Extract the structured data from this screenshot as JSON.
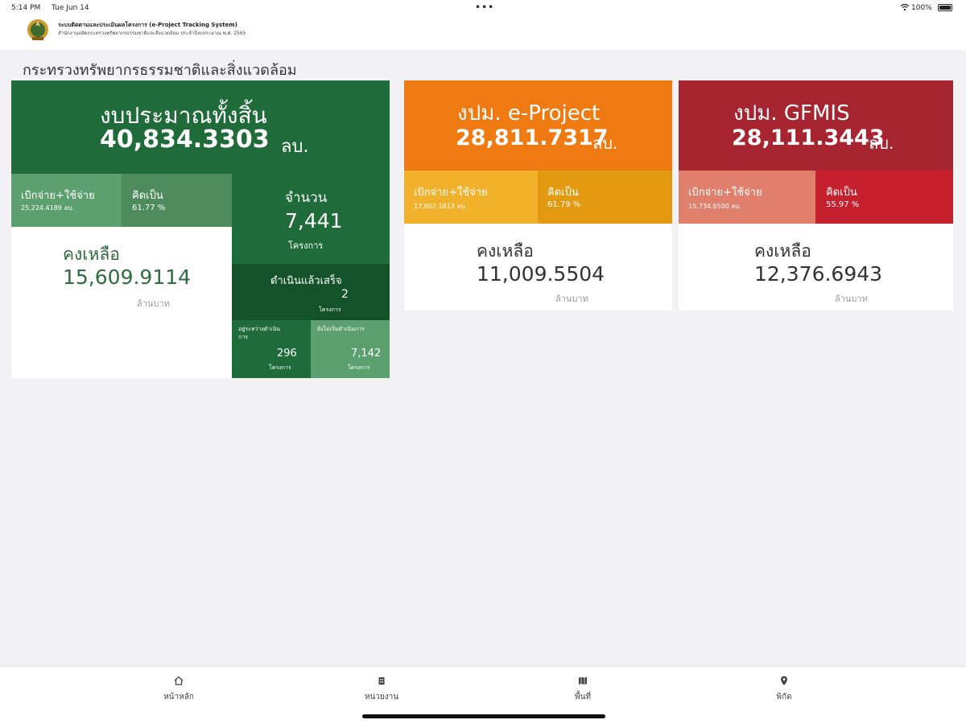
{
  "status": {
    "time": "5:14 PM",
    "date": "Tue Jun 14",
    "battery": "100%"
  },
  "header": {
    "title": "ระบบติดตามและประเมินผลโครงการ (e-Project Tracking System)",
    "subtitle": "สำนักงานปลัดกระทรวงทรัพยากรธรรมชาติและสิ่งแวดล้อม ประจำปีงบประมาณ พ.ศ. 2565"
  },
  "ministry": "กระทรวงทรัพยากรธรรมชาติและสิ่งแวดล้อม",
  "total": {
    "heading": "งบประมาณทั้งสิ้น",
    "amount": "40,834.3303",
    "unit": "ลบ.",
    "spend_label": "เบิกจ่าย+ใช้จ่าย",
    "spend_value": "25,224.4189 ลบ.",
    "pct_label": "คิดเป็น",
    "pct_value": "61.77 %",
    "remain_label": "คงเหลือ",
    "remain_value": "15,609.9114",
    "remain_unit": "ล้านบาท",
    "count_label": "จำนวน",
    "count_value": "7,441",
    "count_unit": "โครงการ",
    "done_label": "ดำเนินแล้วเสร็จ",
    "done_value": "2",
    "done_unit": "โครงการ",
    "progress_label": "อยู่ระหว่างดำเนินการ",
    "progress_value": "296",
    "progress_unit": "โครงการ",
    "notstart_label": "ยังไม่เริ่มดำเนินการ",
    "notstart_value": "7,142",
    "notstart_unit": "โครงการ"
  },
  "eproject": {
    "heading": "งปม. e-Project",
    "amount": "28,811.7317",
    "unit": "ลบ.",
    "spend_label": "เบิกจ่าย+ใช้จ่าย",
    "spend_value": "17,802.1813 ลบ.",
    "pct_label": "คิดเป็น",
    "pct_value": "61.79 %",
    "remain_label": "คงเหลือ",
    "remain_value": "11,009.5504",
    "remain_unit": "ล้านบาท"
  },
  "gfmis": {
    "heading": "งปม. GFMIS",
    "amount": "28,111.3443",
    "unit": "ลบ.",
    "spend_label": "เบิกจ่าย+ใช้จ่าย",
    "spend_value": "15,734.6500 ลบ.",
    "pct_label": "คิดเป็น",
    "pct_value": "55.97 %",
    "remain_label": "คงเหลือ",
    "remain_value": "12,376.6943",
    "remain_unit": "ล้านบาท"
  },
  "tabs": [
    {
      "label": "หน้าหลัก",
      "icon": "home-icon"
    },
    {
      "label": "หน่วยงาน",
      "icon": "building-icon"
    },
    {
      "label": "พื้นที่",
      "icon": "map-icon"
    },
    {
      "label": "พิกัด",
      "icon": "location-pin-icon"
    }
  ],
  "colors": {
    "green_dark": "#1f6b3a",
    "orange": "#ef7a12",
    "red": "#a72530"
  }
}
